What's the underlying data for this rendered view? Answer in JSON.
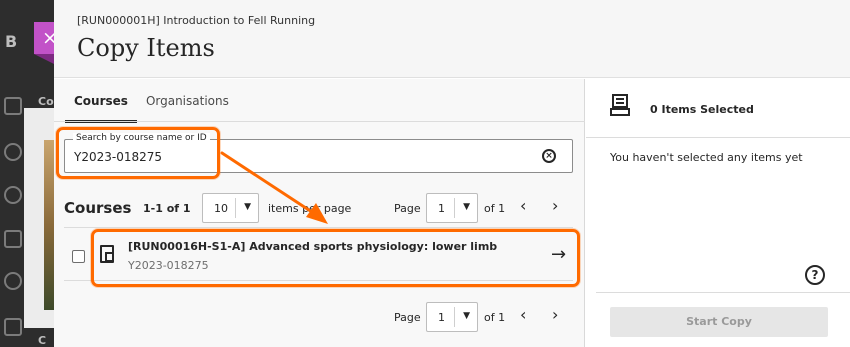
{
  "background": {
    "app_letter": "B",
    "app_letter_2": "Co",
    "app_letter_3": "C"
  },
  "close_label": "×",
  "header": {
    "course_ref": "[RUN000001H] Introduction to Fell Running",
    "title": "Copy Items"
  },
  "tabs": [
    {
      "label": "Courses",
      "active": true
    },
    {
      "label": "Organisations",
      "active": false
    }
  ],
  "search": {
    "label": "Search by course name or ID",
    "value": "Y2023-018275",
    "clear_icon": "⊗"
  },
  "results": {
    "title": "Courses",
    "count": "1-1 of 1",
    "per_page_value": "10",
    "per_page_text": "items per page",
    "page_label": "Page",
    "page_value": "1",
    "of_text": "of 1",
    "prev_label": "‹",
    "next_label": "›"
  },
  "course_row": {
    "name": "[RUN00016H-S1-A] Advanced sports physiology: lower limb",
    "course_id": "Y2023-018275",
    "arrow_label": "→"
  },
  "footer_pagination": {
    "page_label": "Page",
    "page_value": "1",
    "of_text": "of 1",
    "prev_label": "‹",
    "next_label": "›"
  },
  "selection": {
    "count_text": "0 Items Selected",
    "empty_message": "You haven't selected any items yet",
    "help_label": "?",
    "start_copy_label": "Start Copy"
  },
  "colors": {
    "accent": "#c252c8",
    "highlight": "#ff6a00",
    "disabled_button": "#e6e6e6"
  }
}
